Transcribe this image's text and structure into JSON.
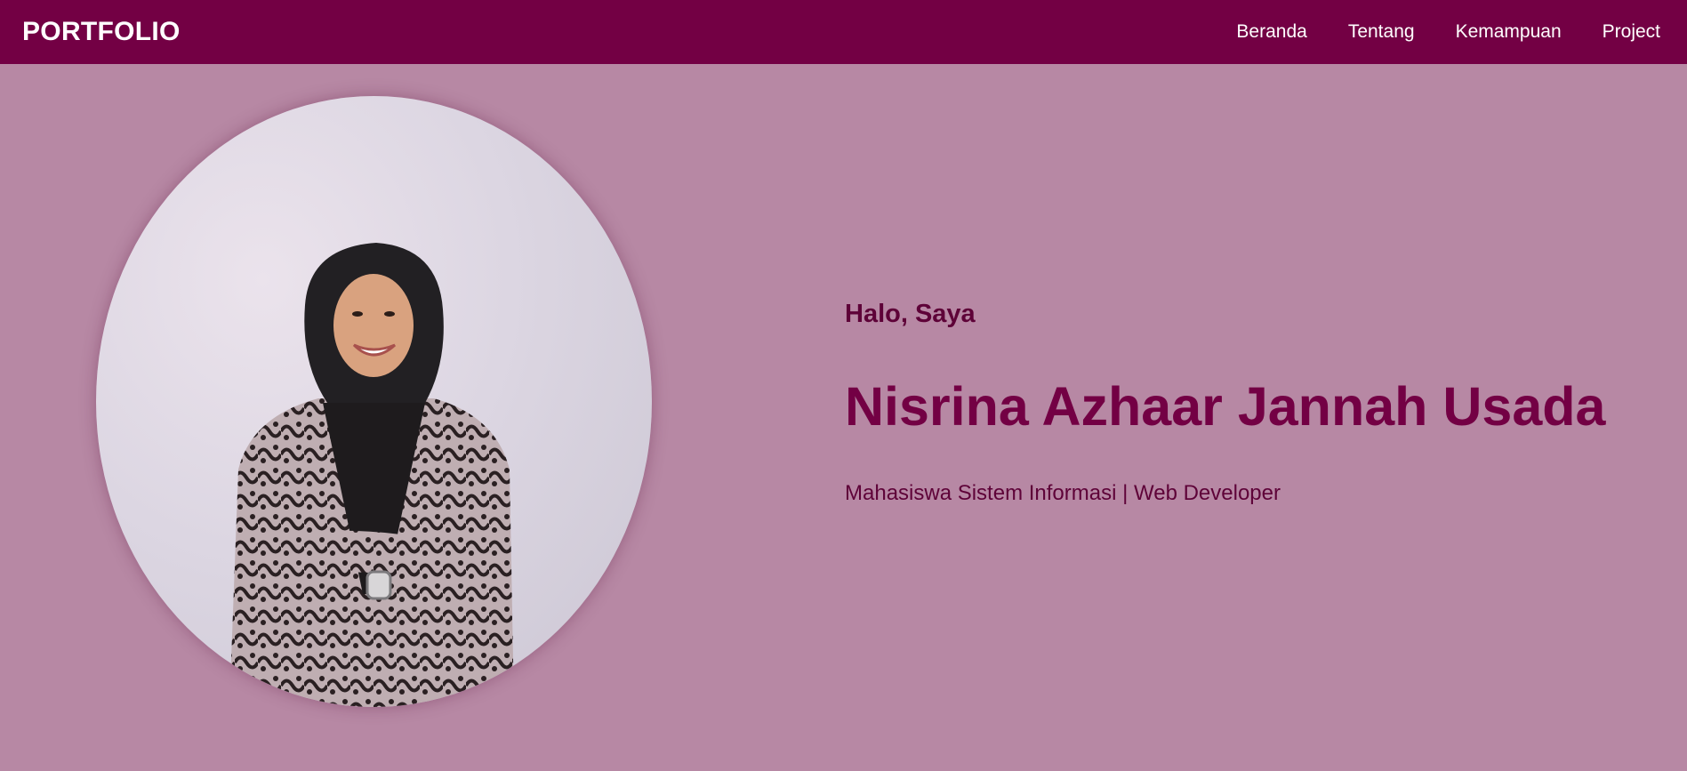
{
  "navbar": {
    "brand": "PORTFOLIO",
    "links": [
      {
        "label": "Beranda"
      },
      {
        "label": "Tentang"
      },
      {
        "label": "Kemampuan"
      },
      {
        "label": "Project"
      }
    ]
  },
  "hero": {
    "greeting": "Halo, Saya",
    "name": "Nisrina Azhaar Jannah Usada",
    "role": "Mahasiswa Sistem Informasi | Web Developer",
    "photo_icon": "profile-photo"
  },
  "colors": {
    "nav_bg": "#730044",
    "page_bg": "#b788a4",
    "accent_text": "#730044",
    "dark_text": "#5e0238"
  }
}
